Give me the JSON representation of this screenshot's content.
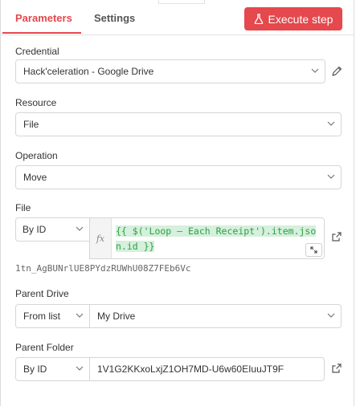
{
  "tabs": {
    "parameters": "Parameters",
    "settings": "Settings"
  },
  "execute_button": {
    "label": "Execute step"
  },
  "credential": {
    "label": "Credential",
    "value": "Hack'celeration - Google Drive"
  },
  "resource": {
    "label": "Resource",
    "value": "File"
  },
  "operation": {
    "label": "Operation",
    "value": "Move"
  },
  "file": {
    "label": "File",
    "mode": "By ID",
    "fx_label": "fx",
    "expression": "{{ $('Loop – Each Receipt').item.json.id }}",
    "resolved_value": "1tn_AgBUNrlUE8PYdzRUWhU08Z7FEb6Vc"
  },
  "parent_drive": {
    "label": "Parent Drive",
    "mode": "From list",
    "value": "My Drive"
  },
  "parent_folder": {
    "label": "Parent Folder",
    "mode": "By ID",
    "value": "1V1G2KKxoLxjZ1OH7MD-U6w60EIuuJT9F"
  },
  "colors": {
    "accent": "#e5484d",
    "expression_text": "#2f9e44",
    "expression_bg": "#d5f0dc"
  }
}
